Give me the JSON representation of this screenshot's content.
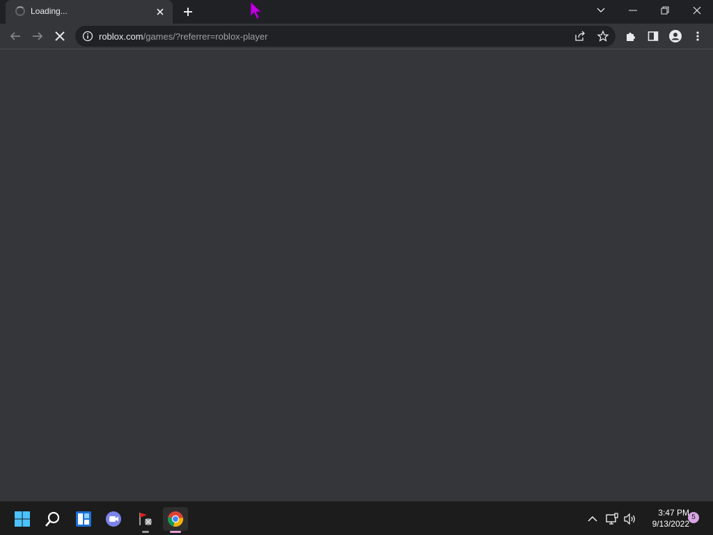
{
  "tab": {
    "title": "Loading...",
    "close_icon": "close-icon"
  },
  "toolbar": {
    "url_host": "roblox.com",
    "url_path": "/games/?referrer=roblox-player"
  },
  "taskbar": {
    "time": "3:47 PM",
    "date": "9/13/2022",
    "notification_count": "5"
  },
  "colors": {
    "titlebar_bg": "#202124",
    "toolbar_bg": "#35363a",
    "omnibox_bg": "#202124",
    "taskbar_bg": "#1c1c1c",
    "cursor": "#c000e0"
  }
}
